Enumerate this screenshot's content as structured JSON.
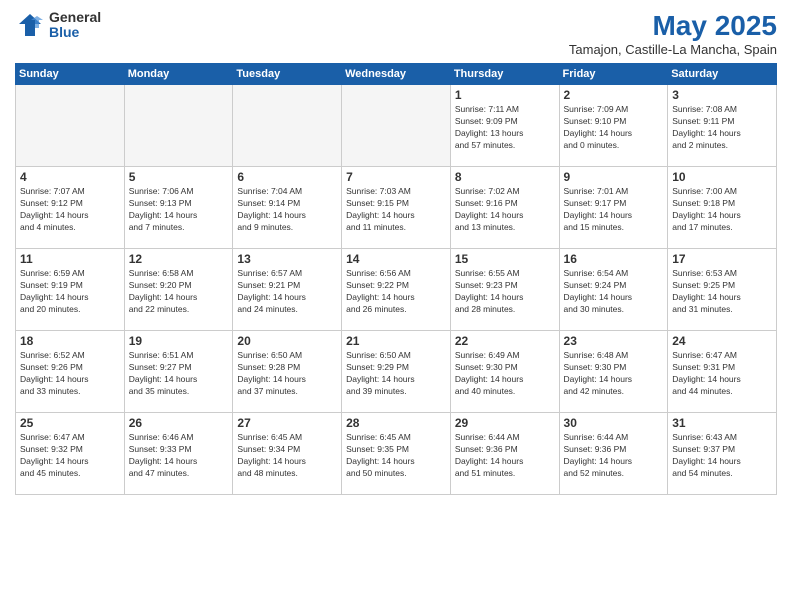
{
  "header": {
    "logo_general": "General",
    "logo_blue": "Blue",
    "month_title": "May 2025",
    "location": "Tamajon, Castille-La Mancha, Spain"
  },
  "days_of_week": [
    "Sunday",
    "Monday",
    "Tuesday",
    "Wednesday",
    "Thursday",
    "Friday",
    "Saturday"
  ],
  "weeks": [
    [
      {
        "day": "",
        "info": ""
      },
      {
        "day": "",
        "info": ""
      },
      {
        "day": "",
        "info": ""
      },
      {
        "day": "",
        "info": ""
      },
      {
        "day": "1",
        "info": "Sunrise: 7:11 AM\nSunset: 9:09 PM\nDaylight: 13 hours\nand 57 minutes."
      },
      {
        "day": "2",
        "info": "Sunrise: 7:09 AM\nSunset: 9:10 PM\nDaylight: 14 hours\nand 0 minutes."
      },
      {
        "day": "3",
        "info": "Sunrise: 7:08 AM\nSunset: 9:11 PM\nDaylight: 14 hours\nand 2 minutes."
      }
    ],
    [
      {
        "day": "4",
        "info": "Sunrise: 7:07 AM\nSunset: 9:12 PM\nDaylight: 14 hours\nand 4 minutes."
      },
      {
        "day": "5",
        "info": "Sunrise: 7:06 AM\nSunset: 9:13 PM\nDaylight: 14 hours\nand 7 minutes."
      },
      {
        "day": "6",
        "info": "Sunrise: 7:04 AM\nSunset: 9:14 PM\nDaylight: 14 hours\nand 9 minutes."
      },
      {
        "day": "7",
        "info": "Sunrise: 7:03 AM\nSunset: 9:15 PM\nDaylight: 14 hours\nand 11 minutes."
      },
      {
        "day": "8",
        "info": "Sunrise: 7:02 AM\nSunset: 9:16 PM\nDaylight: 14 hours\nand 13 minutes."
      },
      {
        "day": "9",
        "info": "Sunrise: 7:01 AM\nSunset: 9:17 PM\nDaylight: 14 hours\nand 15 minutes."
      },
      {
        "day": "10",
        "info": "Sunrise: 7:00 AM\nSunset: 9:18 PM\nDaylight: 14 hours\nand 17 minutes."
      }
    ],
    [
      {
        "day": "11",
        "info": "Sunrise: 6:59 AM\nSunset: 9:19 PM\nDaylight: 14 hours\nand 20 minutes."
      },
      {
        "day": "12",
        "info": "Sunrise: 6:58 AM\nSunset: 9:20 PM\nDaylight: 14 hours\nand 22 minutes."
      },
      {
        "day": "13",
        "info": "Sunrise: 6:57 AM\nSunset: 9:21 PM\nDaylight: 14 hours\nand 24 minutes."
      },
      {
        "day": "14",
        "info": "Sunrise: 6:56 AM\nSunset: 9:22 PM\nDaylight: 14 hours\nand 26 minutes."
      },
      {
        "day": "15",
        "info": "Sunrise: 6:55 AM\nSunset: 9:23 PM\nDaylight: 14 hours\nand 28 minutes."
      },
      {
        "day": "16",
        "info": "Sunrise: 6:54 AM\nSunset: 9:24 PM\nDaylight: 14 hours\nand 30 minutes."
      },
      {
        "day": "17",
        "info": "Sunrise: 6:53 AM\nSunset: 9:25 PM\nDaylight: 14 hours\nand 31 minutes."
      }
    ],
    [
      {
        "day": "18",
        "info": "Sunrise: 6:52 AM\nSunset: 9:26 PM\nDaylight: 14 hours\nand 33 minutes."
      },
      {
        "day": "19",
        "info": "Sunrise: 6:51 AM\nSunset: 9:27 PM\nDaylight: 14 hours\nand 35 minutes."
      },
      {
        "day": "20",
        "info": "Sunrise: 6:50 AM\nSunset: 9:28 PM\nDaylight: 14 hours\nand 37 minutes."
      },
      {
        "day": "21",
        "info": "Sunrise: 6:50 AM\nSunset: 9:29 PM\nDaylight: 14 hours\nand 39 minutes."
      },
      {
        "day": "22",
        "info": "Sunrise: 6:49 AM\nSunset: 9:30 PM\nDaylight: 14 hours\nand 40 minutes."
      },
      {
        "day": "23",
        "info": "Sunrise: 6:48 AM\nSunset: 9:30 PM\nDaylight: 14 hours\nand 42 minutes."
      },
      {
        "day": "24",
        "info": "Sunrise: 6:47 AM\nSunset: 9:31 PM\nDaylight: 14 hours\nand 44 minutes."
      }
    ],
    [
      {
        "day": "25",
        "info": "Sunrise: 6:47 AM\nSunset: 9:32 PM\nDaylight: 14 hours\nand 45 minutes."
      },
      {
        "day": "26",
        "info": "Sunrise: 6:46 AM\nSunset: 9:33 PM\nDaylight: 14 hours\nand 47 minutes."
      },
      {
        "day": "27",
        "info": "Sunrise: 6:45 AM\nSunset: 9:34 PM\nDaylight: 14 hours\nand 48 minutes."
      },
      {
        "day": "28",
        "info": "Sunrise: 6:45 AM\nSunset: 9:35 PM\nDaylight: 14 hours\nand 50 minutes."
      },
      {
        "day": "29",
        "info": "Sunrise: 6:44 AM\nSunset: 9:36 PM\nDaylight: 14 hours\nand 51 minutes."
      },
      {
        "day": "30",
        "info": "Sunrise: 6:44 AM\nSunset: 9:36 PM\nDaylight: 14 hours\nand 52 minutes."
      },
      {
        "day": "31",
        "info": "Sunrise: 6:43 AM\nSunset: 9:37 PM\nDaylight: 14 hours\nand 54 minutes."
      }
    ]
  ]
}
